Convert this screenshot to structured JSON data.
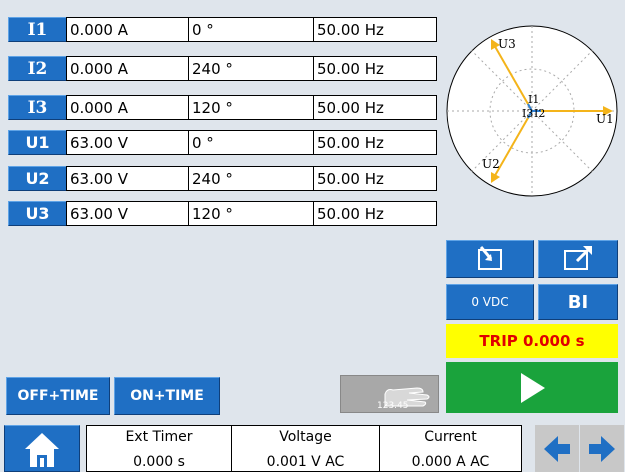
{
  "channels": [
    {
      "label": "I1",
      "magnitude": "0.000 A",
      "phase": "0 °",
      "frequency": "50.00 Hz"
    },
    {
      "label": "I2",
      "magnitude": "0.000 A",
      "phase": "240 °",
      "frequency": "50.00 Hz"
    },
    {
      "label": "I3",
      "magnitude": "0.000 A",
      "phase": "120 °",
      "frequency": "50.00 Hz"
    },
    {
      "label": "U1",
      "magnitude": "63.00 V",
      "phase": "0 °",
      "frequency": "50.00 Hz"
    },
    {
      "label": "U2",
      "magnitude": "63.00 V",
      "phase": "240 °",
      "frequency": "50.00 Hz"
    },
    {
      "label": "U3",
      "magnitude": "63.00 V",
      "phase": "120 °",
      "frequency": "50.00 Hz"
    }
  ],
  "phasor": {
    "labels": {
      "u1": "U1",
      "u2": "U2",
      "u3": "U3",
      "i1": "I1",
      "i2": "I2",
      "i3": "I3"
    },
    "u_color": "#f4b41a",
    "i_color": "#2b7fd6"
  },
  "controls": {
    "dc_label": "0 VDC",
    "bi_label": "BI",
    "trip_text": "TRIP 0.000 s",
    "off_time_label": "OFF+TIME",
    "on_time_label": "ON+TIME",
    "keypad_label": "123.45"
  },
  "status": {
    "ext_timer_label": "Ext Timer",
    "ext_timer_value": "0.000 s",
    "voltage_label": "Voltage",
    "voltage_value": "0.001 V AC",
    "current_label": "Current",
    "current_value": "0.000 A AC"
  },
  "icons": {
    "import": "import-icon",
    "export": "export-icon",
    "play": "play-icon",
    "home": "home-icon",
    "left": "arrow-left-icon",
    "right": "arrow-right-icon"
  },
  "colors": {
    "blue": "#1f6fc4",
    "green": "#1aa33c",
    "yellow": "#ffff00",
    "trip_red": "#e00000"
  }
}
